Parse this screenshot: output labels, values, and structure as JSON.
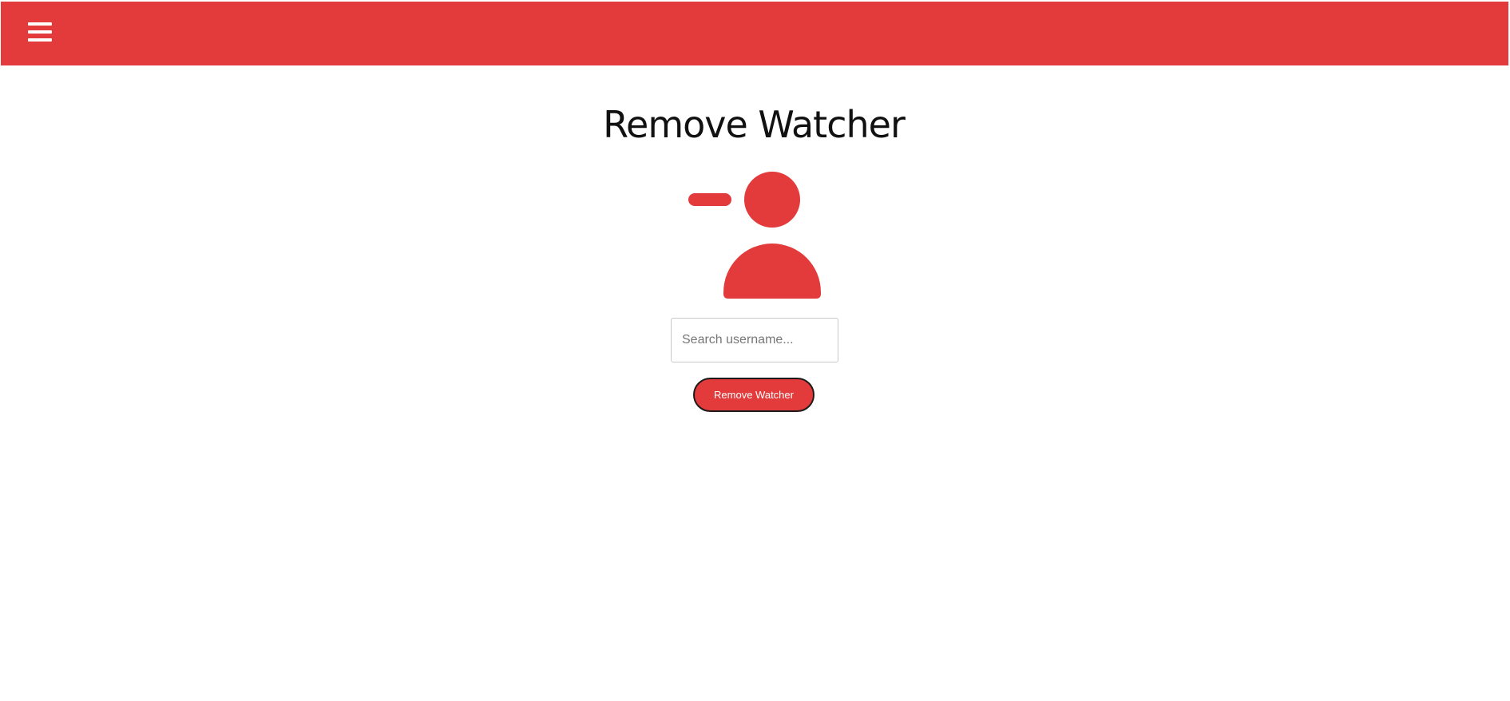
{
  "header": {
    "background_color": "#e33b3c",
    "menu_icon": "hamburger-menu-icon"
  },
  "main": {
    "title": "Remove Watcher",
    "illustration_icon": "user-minus-icon",
    "accent_color": "#e33b3c",
    "search": {
      "placeholder": "Search username...",
      "value": ""
    },
    "submit_label": "Remove Watcher"
  }
}
